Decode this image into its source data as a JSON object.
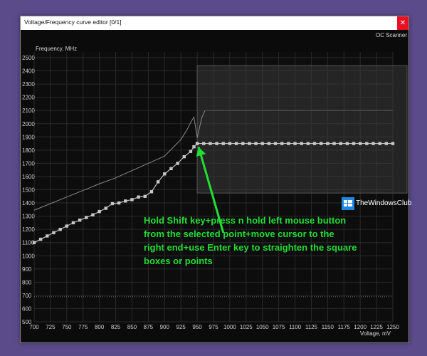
{
  "window": {
    "title": "Voltage/Frequency curve editor [0/1]",
    "close_glyph": "✕",
    "oc_scanner_label": "OC Scanner"
  },
  "watermark": {
    "text": "TheWindowsClub"
  },
  "annotation": {
    "lines": [
      "Hold Shift key+press n hold left mouse button",
      "from the selected point+move cursor to the",
      "right end+use Enter key to straighten the square",
      "boxes or points"
    ]
  },
  "colors": {
    "background": "#5b4b8a",
    "annotation": "#22dd33",
    "curve": "#9a9a9a",
    "arrow": "#22dd33",
    "close": "#e81123"
  },
  "chart_data": {
    "type": "line",
    "ylabel": "Frequency, MHz",
    "xlabel": "Voltage, mV",
    "xlim": [
      700,
      1250
    ],
    "ylim": [
      500,
      2500
    ],
    "x_ticks": [
      700,
      725,
      750,
      775,
      800,
      825,
      850,
      875,
      900,
      925,
      950,
      975,
      1000,
      1025,
      1050,
      1075,
      1100,
      1125,
      1150,
      1175,
      1200,
      1225,
      1250
    ],
    "y_ticks": [
      500,
      600,
      700,
      800,
      900,
      1000,
      1100,
      1200,
      1300,
      1400,
      1500,
      1600,
      1700,
      1800,
      1900,
      2000,
      2100,
      2200,
      2300,
      2400,
      2500
    ],
    "reference_line": {
      "y": 690
    },
    "selection_region": {
      "x": [
        950,
        1250
      ],
      "y": [
        1475,
        2440
      ]
    },
    "series": [
      {
        "style": "line",
        "x": [
          700,
          725,
          750,
          775,
          800,
          825,
          850,
          875,
          900,
          925,
          935,
          940,
          945,
          950,
          957,
          962
        ],
        "y": [
          1345,
          1395,
          1445,
          1495,
          1545,
          1590,
          1645,
          1700,
          1755,
          1880,
          1960,
          2010,
          2050,
          1895,
          2045,
          2100
        ]
      },
      {
        "style": "line",
        "x": [
          962,
          1250
        ],
        "y": [
          2100,
          2100
        ]
      },
      {
        "style": "markers",
        "x": [
          700,
          710,
          720,
          730,
          740,
          750,
          760,
          770,
          780,
          790,
          800,
          810,
          820,
          830,
          840,
          850,
          860,
          870,
          880,
          890,
          900,
          910,
          920,
          930,
          940,
          945,
          950,
          960,
          970,
          980,
          990,
          1000,
          1010,
          1020,
          1030,
          1040,
          1050,
          1060,
          1070,
          1080,
          1090,
          1100,
          1110,
          1120,
          1130,
          1140,
          1150,
          1160,
          1170,
          1180,
          1190,
          1200,
          1210,
          1220,
          1230,
          1240,
          1250
        ],
        "y": [
          1100,
          1125,
          1150,
          1175,
          1200,
          1225,
          1250,
          1270,
          1290,
          1310,
          1335,
          1360,
          1395,
          1400,
          1415,
          1425,
          1445,
          1450,
          1485,
          1560,
          1620,
          1660,
          1700,
          1750,
          1790,
          1825,
          1850,
          1850,
          1850,
          1850,
          1850,
          1850,
          1850,
          1850,
          1850,
          1850,
          1850,
          1850,
          1850,
          1850,
          1850,
          1850,
          1850,
          1850,
          1850,
          1850,
          1850,
          1850,
          1850,
          1850,
          1850,
          1850,
          1850,
          1850,
          1850,
          1850,
          1850
        ]
      }
    ],
    "arrow": {
      "from": [
        990,
        1175
      ],
      "to": [
        950,
        1845
      ]
    },
    "grid": true
  }
}
